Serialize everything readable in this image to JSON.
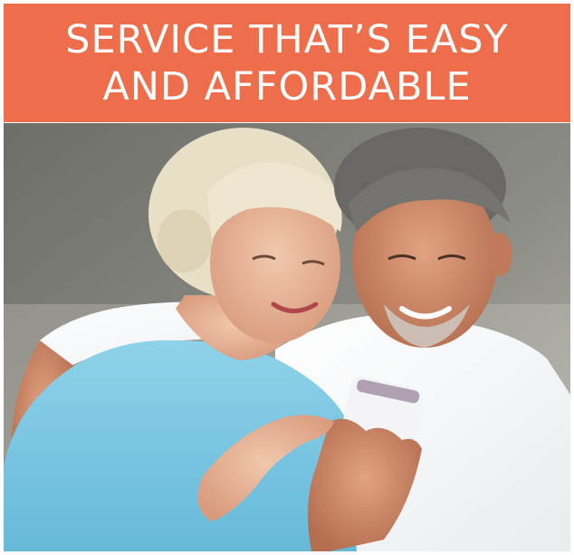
{
  "banner": {
    "line1": "SERVICE THAT’S EASY",
    "line2": "AND AFFORDABLE",
    "background": "#ee6e4c",
    "text_color": "#ffffff"
  },
  "photo": {
    "subject": "older-couple-looking-at-smartphone"
  }
}
